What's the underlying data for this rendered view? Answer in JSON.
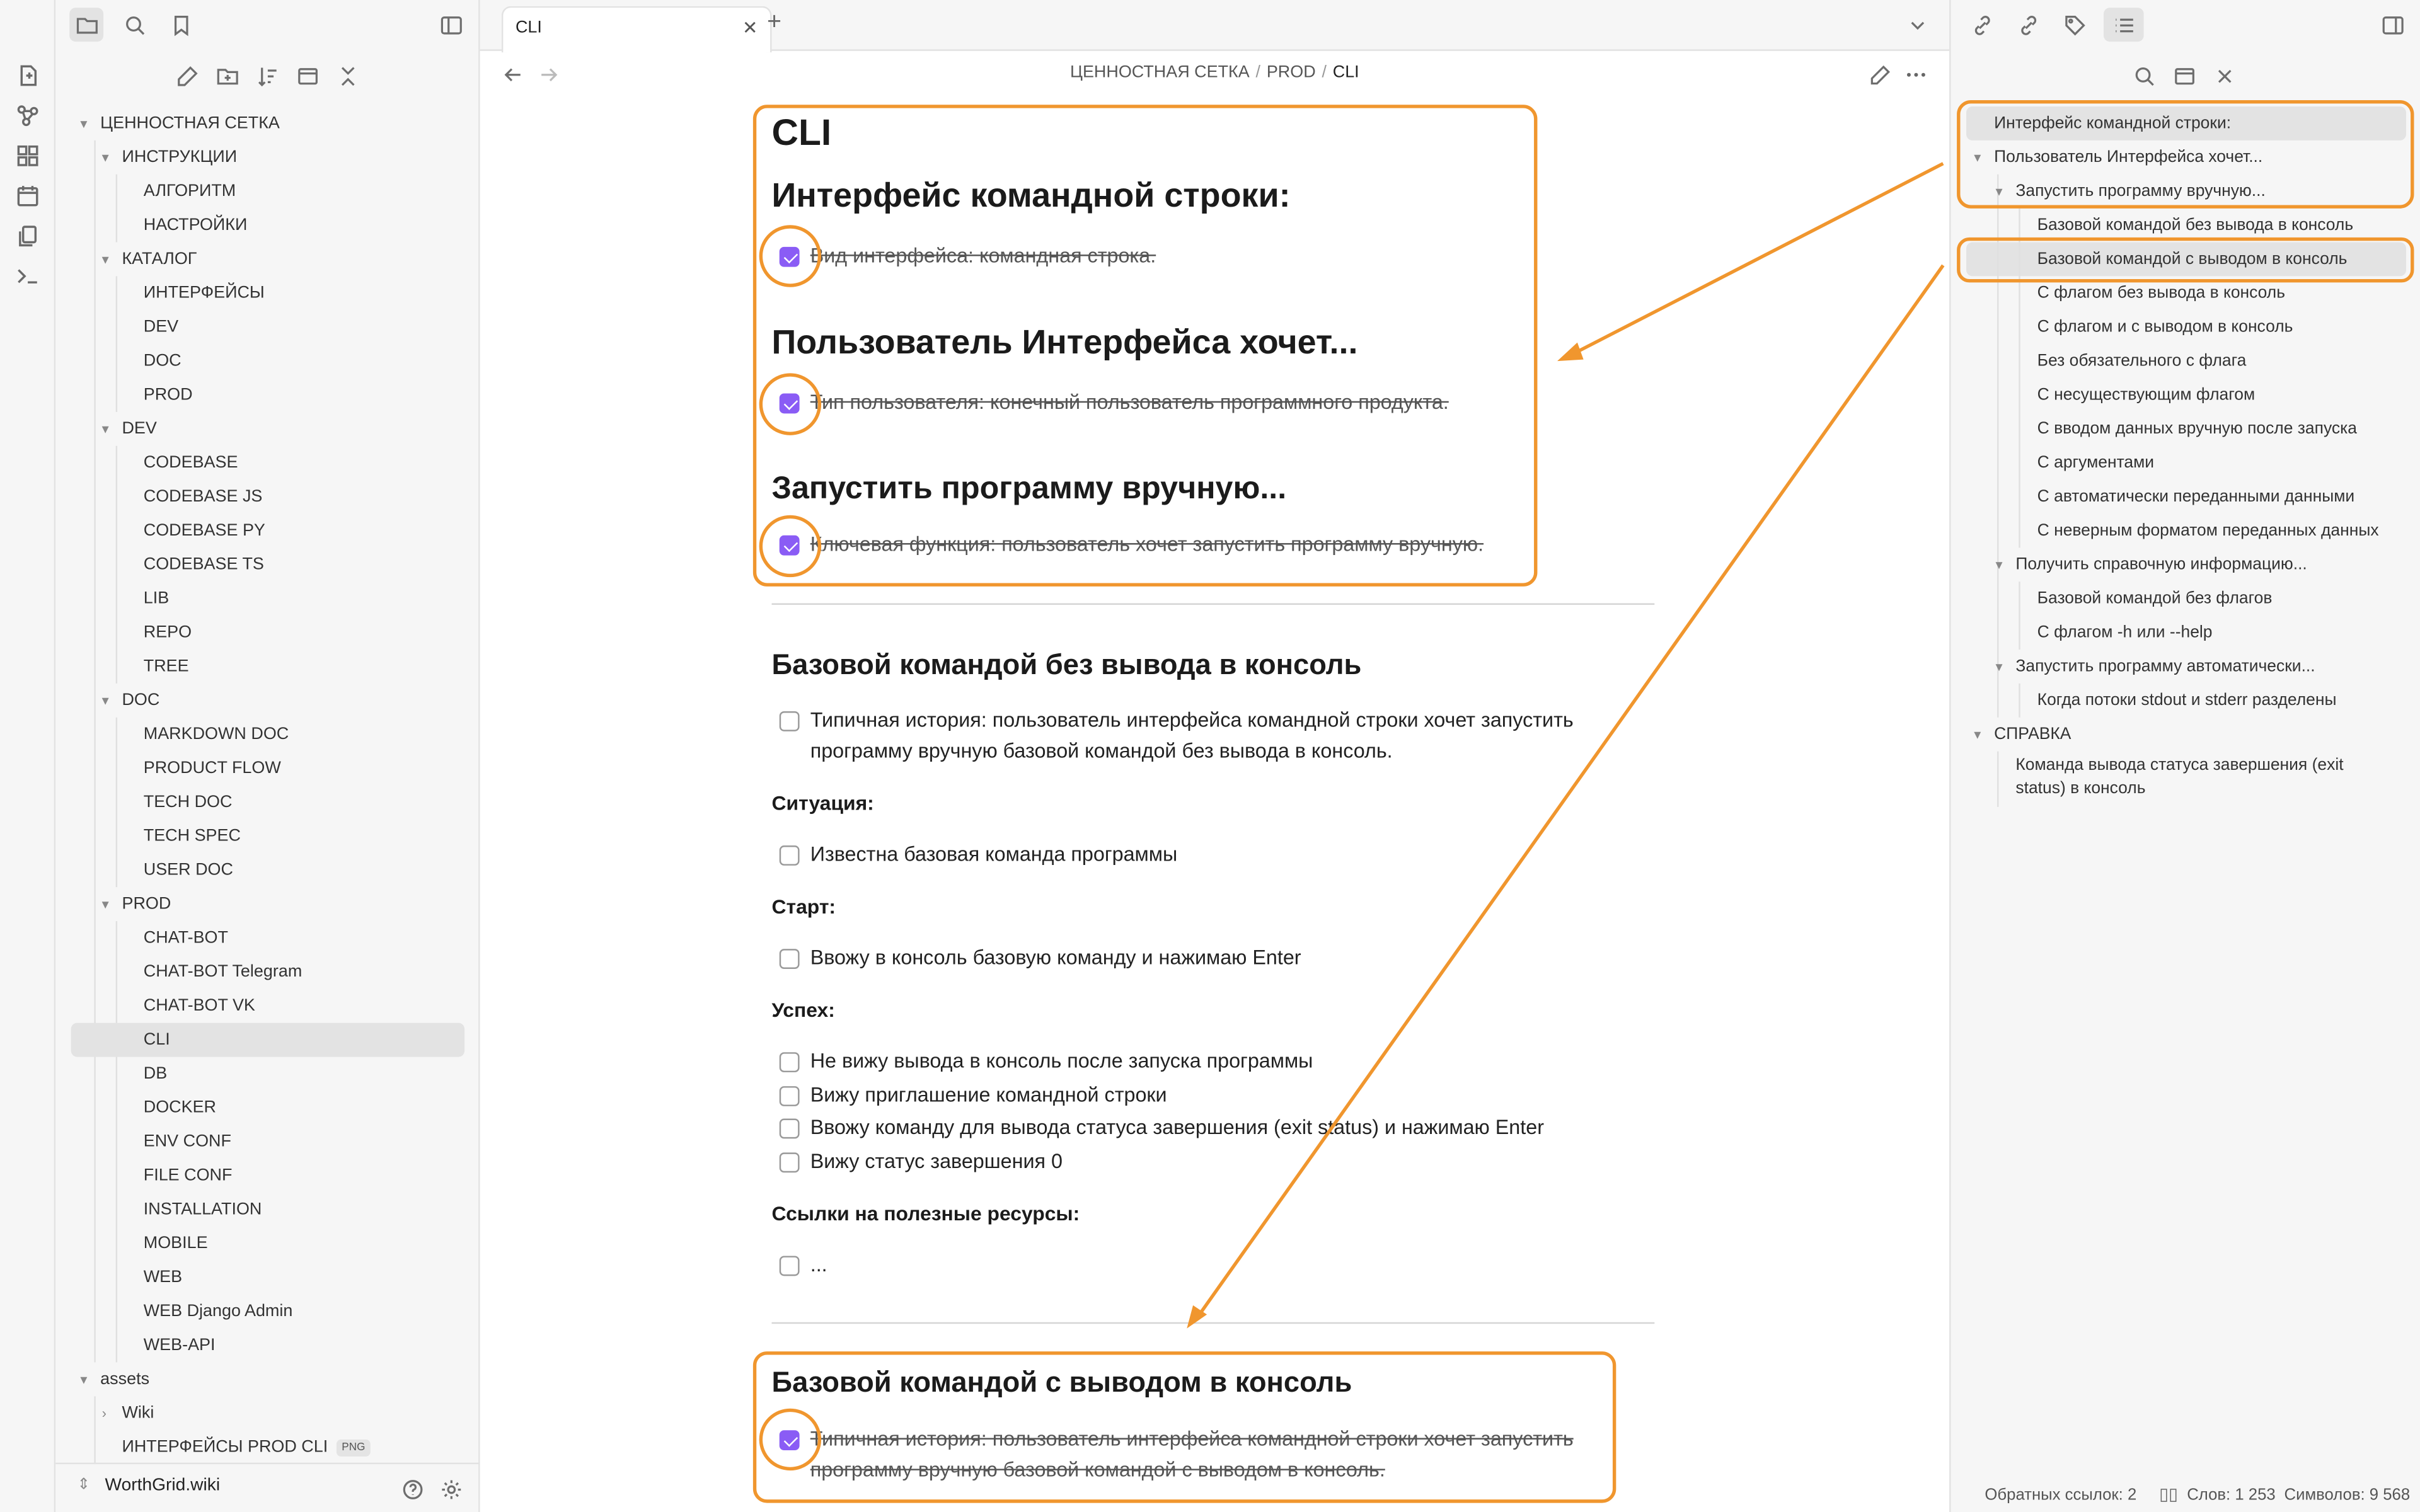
{
  "tab": {
    "title": "CLI"
  },
  "breadcrumb": {
    "part1": "ЦЕННОСТНАЯ СЕТКА",
    "part2": "PROD",
    "part3": "CLI",
    "sep": "/"
  },
  "tree": {
    "root": "ЦЕННОСТНАЯ СЕТКА",
    "instr": "ИНСТРУКЦИИ",
    "algo": "АЛГОРИТМ",
    "settings": "НАСТРОЙКИ",
    "catalog": "КАТАЛОГ",
    "interfaces": "ИНТЕРФЕЙСЫ",
    "cat_dev": "DEV",
    "cat_doc": "DOC",
    "cat_prod": "PROD",
    "dev": "DEV",
    "codebase": "CODEBASE",
    "codebase_js": "CODEBASE JS",
    "codebase_py": "CODEBASE PY",
    "codebase_ts": "CODEBASE TS",
    "lib": "LIB",
    "repo": "REPO",
    "tree": "TREE",
    "doc": "DOC",
    "markdown_doc": "MARKDOWN DOC",
    "product_flow": "PRODUCT FLOW",
    "tech_doc": "TECH DOC",
    "tech_spec": "TECH SPEC",
    "user_doc": "USER DOC",
    "prod": "PROD",
    "chatbot": "CHAT-BOT",
    "chatbot_tg": "CHAT-BOT Telegram",
    "chatbot_vk": "CHAT-BOT VK",
    "cli": "CLI",
    "db": "DB",
    "docker": "DOCKER",
    "env_conf": "ENV CONF",
    "file_conf": "FILE CONF",
    "installation": "INSTALLATION",
    "mobile": "MOBILE",
    "web": "WEB",
    "web_django": "WEB Django Admin",
    "web_api": "WEB-API",
    "assets": "assets",
    "wiki": "Wiki",
    "png_file": "ИНТЕРФЕЙСЫ PROD CLI",
    "png_tag": "PNG"
  },
  "vault": {
    "name": "WorthGrid.wiki"
  },
  "doc": {
    "title": "CLI",
    "h_interface": "Интерфейс командной строки:",
    "t_interface": "Вид интерфейса: командная строка.",
    "h_user": "Пользователь Интерфейса хочет...",
    "t_user": "Тип пользователя: конечный пользователь программного продукта.",
    "h_run": "Запустить программу вручную...",
    "t_run": "Ключевая функция: пользователь хочет запустить программу вручную.",
    "h_base_noout": "Базовой командой без вывода в консоль",
    "t_story1": "Типичная история: пользователь интерфейса командной строки хочет запустить программу вручную базовой командой без вывода в консоль.",
    "situation": "Ситуация:",
    "t_known": "Известна базовая команда программы",
    "start": "Старт:",
    "t_enter": "Ввожу в консоль базовую команду и нажимаю Enter",
    "success": "Успех:",
    "s1": "Не вижу вывода в консоль после запуска программы",
    "s2": "Вижу приглашение командной строки",
    "s3": "Ввожу команду для вывода статуса завершения (exit status) и нажимаю Enter",
    "s4": "Вижу статус завершения 0",
    "links": "Ссылки на полезные ресурсы:",
    "t_dots": "...",
    "h_base_out": "Базовой командой с выводом в консоль",
    "t_story2": "Типичная история: пользователь интерфейса командной строки хочет запустить программу вручную базовой командой с выводом в консоль."
  },
  "outline": {
    "o1": "Интерфейс командной строки:",
    "o2": "Пользователь Интерфейса хочет...",
    "o3": "Запустить программу вручную...",
    "o4": "Базовой командой без вывода в консоль",
    "o5": "Базовой командой с выводом в консоль",
    "o6": "С флагом без вывода в консоль",
    "o7": "С флагом и с выводом в консоль",
    "o8": "Без обязательного с флага",
    "o9": "С несуществующим флагом",
    "o10": "С вводом данных вручную после запуска",
    "o11": "С аргументами",
    "o12": "С автоматически переданными данными",
    "o13": "С неверным форматом переданных данных",
    "o14": "Получить справочную информацию...",
    "o15": "Базовой командой без флагов",
    "o16": "С флагом -h или --help",
    "o17": "Запустить программу автоматически...",
    "o18": "Когда потоки stdout и stderr разделены",
    "o19": "СПРАВКА",
    "o20a": "Команда вывода статуса завершения (exit",
    "o20b": "status) в консоль"
  },
  "status": {
    "backlinks": "Обратных ссылок: 2",
    "words": "Слов: 1 253",
    "chars": "Символов: 9 568"
  },
  "colors": {
    "accent": "#8a5cf5",
    "annotation": "#f0962e"
  }
}
